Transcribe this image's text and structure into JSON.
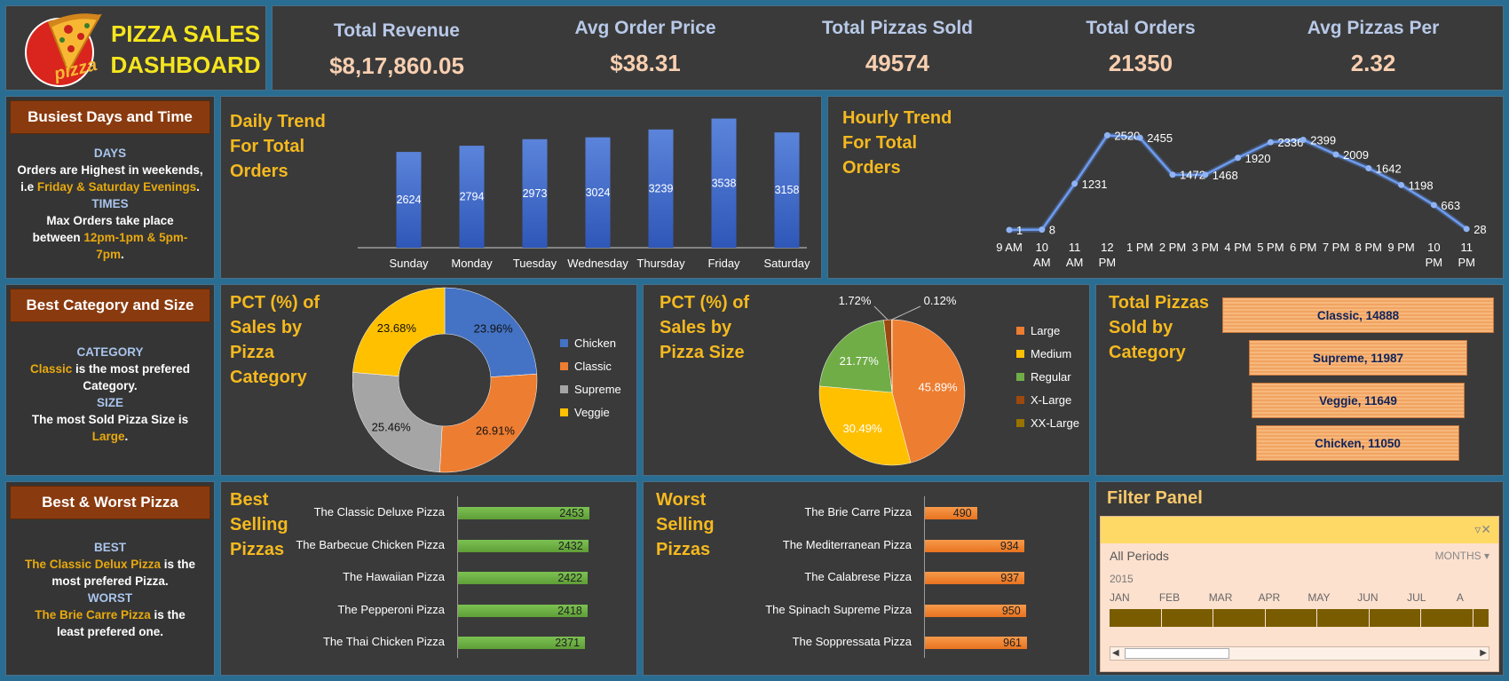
{
  "header": {
    "title_line1": "PIZZA SALES",
    "title_line2": "DASHBOARD",
    "logo_text": "pizza"
  },
  "kpis": [
    {
      "title": "Total Revenue",
      "value": "$8,17,860.05"
    },
    {
      "title": "Avg Order Price",
      "value": "$38.31"
    },
    {
      "title": "Total Pizzas Sold",
      "value": "49574"
    },
    {
      "title": "Total Orders",
      "value": "21350"
    },
    {
      "title": "Avg Pizzas Per",
      "value": "2.32"
    }
  ],
  "side": {
    "busiest": {
      "title": "Busiest Days and Time",
      "days_label": "DAYS",
      "days_text1": "Orders are Highest in weekends,",
      "days_text2a": "i.e ",
      "days_hl": "Friday & Saturday Evenings",
      "days_text2b": ".",
      "times_label": "TIMES",
      "times_text1": "Max Orders take place",
      "times_text2a": "between ",
      "times_hl1": "12pm-1pm & 5pm-",
      "times_hl2": "7pm",
      "times_text3": "."
    },
    "category": {
      "title": "Best Category and Size",
      "cat_label": "CATEGORY",
      "cat_hl": "Classic",
      "cat_text1": " is the most prefered",
      "cat_text2": "Category.",
      "size_label": "SIZE",
      "size_text": "The most Sold Pizza Size is",
      "size_hl": "Large",
      "size_end": "."
    },
    "bestworst": {
      "title": "Best & Worst Pizza",
      "best_label": "BEST",
      "best_hl": "The Classic Delux Pizza",
      "best_text1": " is the",
      "best_text2": "most prefered Pizza.",
      "worst_label": "WORST",
      "worst_hl": "The Brie Carre Pizza",
      "worst_text1": " is the",
      "worst_text2": "least prefered one."
    }
  },
  "chart_data": [
    {
      "type": "bar",
      "title": "Daily Trend For Total Orders",
      "title_lines": [
        "Daily Trend",
        "For Total",
        "Orders"
      ],
      "categories": [
        "Sunday",
        "Monday",
        "Tuesday",
        "Wednesday",
        "Thursday",
        "Friday",
        "Saturday"
      ],
      "values": [
        2624,
        2794,
        2973,
        3024,
        3239,
        3538,
        3158
      ],
      "color": "#3d67c9"
    },
    {
      "type": "line",
      "title": "Hourly Trend For Total Orders",
      "title_lines": [
        "Hourly Trend",
        "For Total",
        "Orders"
      ],
      "categories": [
        "9 AM",
        "10 AM",
        "11 AM",
        "12 PM",
        "1 PM",
        "2 PM",
        "3 PM",
        "4 PM",
        "5 PM",
        "6 PM",
        "7 PM",
        "8 PM",
        "9 PM",
        "10 PM",
        "11 PM"
      ],
      "category_lines": [
        [
          "9 AM"
        ],
        [
          "10",
          "AM"
        ],
        [
          "11",
          "AM"
        ],
        [
          "12",
          "PM"
        ],
        [
          "1 PM"
        ],
        [
          "2 PM"
        ],
        [
          "3 PM"
        ],
        [
          "4 PM"
        ],
        [
          "5 PM"
        ],
        [
          "6 PM"
        ],
        [
          "7 PM"
        ],
        [
          "8 PM"
        ],
        [
          "9 PM"
        ],
        [
          "10",
          "PM"
        ],
        [
          "11",
          "PM"
        ]
      ],
      "values": [
        1,
        8,
        1231,
        2520,
        2455,
        1472,
        1468,
        1920,
        2336,
        2399,
        2009,
        1642,
        1198,
        663,
        28
      ],
      "color": "#5b8ee8"
    },
    {
      "type": "pie",
      "title": "PCT (%) of Sales by Pizza Category",
      "title_lines": [
        "PCT (%) of",
        "Sales by",
        "Pizza",
        "Category"
      ],
      "donut": true,
      "labels": [
        "Chicken",
        "Classic",
        "Supreme",
        "Veggie"
      ],
      "values": [
        23.96,
        26.91,
        25.46,
        23.68
      ],
      "value_labels": [
        "23.96%",
        "26.91%",
        "25.46%",
        "23.68%"
      ],
      "colors": [
        "#4472c4",
        "#ed7d31",
        "#a5a5a5",
        "#ffc000"
      ],
      "legend": "right"
    },
    {
      "type": "pie",
      "title": "PCT (%) of Sales by Pizza Size",
      "title_lines": [
        "PCT (%) of",
        "Sales by",
        "Pizza Size"
      ],
      "labels": [
        "Large",
        "Medium",
        "Regular",
        "X-Large",
        "XX-Large"
      ],
      "values": [
        45.89,
        30.49,
        21.77,
        1.72,
        0.12
      ],
      "value_labels": [
        "45.89%",
        "30.49%",
        "21.77%",
        "1.72%",
        "0.12%"
      ],
      "colors": [
        "#ed7d31",
        "#ffc000",
        "#70ad47",
        "#9e480e",
        "#997300"
      ],
      "legend": "right"
    },
    {
      "type": "bar",
      "orientation": "horizontal",
      "title": "Total Pizzas Sold by Category",
      "title_lines": [
        "Total Pizzas",
        "Sold by",
        "Category"
      ],
      "categories": [
        "Classic",
        "Supreme",
        "Veggie",
        "Chicken"
      ],
      "values": [
        14888,
        11987,
        11649,
        11050
      ],
      "labels": [
        "Classic, 14888",
        "Supreme, 11987",
        "Veggie, 11649",
        "Chicken, 11050"
      ]
    },
    {
      "type": "bar",
      "orientation": "horizontal",
      "title": "Best Selling Pizzas",
      "title_lines": [
        "Best",
        "Selling",
        "Pizzas"
      ],
      "categories": [
        "The Classic Deluxe Pizza",
        "The Barbecue Chicken Pizza",
        "The Hawaiian Pizza",
        "The Pepperoni Pizza",
        "The Thai Chicken Pizza"
      ],
      "values": [
        2453,
        2432,
        2422,
        2418,
        2371
      ],
      "color": "#70ad47"
    },
    {
      "type": "bar",
      "orientation": "horizontal",
      "title": "Worst Selling Pizzas",
      "title_lines": [
        "Worst",
        "Selling",
        "Pizzas"
      ],
      "categories": [
        "The Brie Carre Pizza",
        "The Mediterranean Pizza",
        "The Calabrese Pizza",
        "The Spinach Supreme Pizza",
        "The Soppressata Pizza"
      ],
      "values": [
        490,
        934,
        937,
        950,
        961
      ],
      "color": "#ed7d31"
    }
  ],
  "filter": {
    "title": "Filter Panel",
    "period_label": "All Periods",
    "period_unit": "MONTHS",
    "year": "2015",
    "months": [
      "JAN",
      "FEB",
      "MAR",
      "APR",
      "MAY",
      "JUN",
      "JUL",
      "A"
    ],
    "clear_icon": "clear-filter-icon",
    "dropdown_icon": "chevron-down-icon",
    "scroll_left_icon": "triangle-left-icon",
    "scroll_right_icon": "triangle-right-icon"
  }
}
